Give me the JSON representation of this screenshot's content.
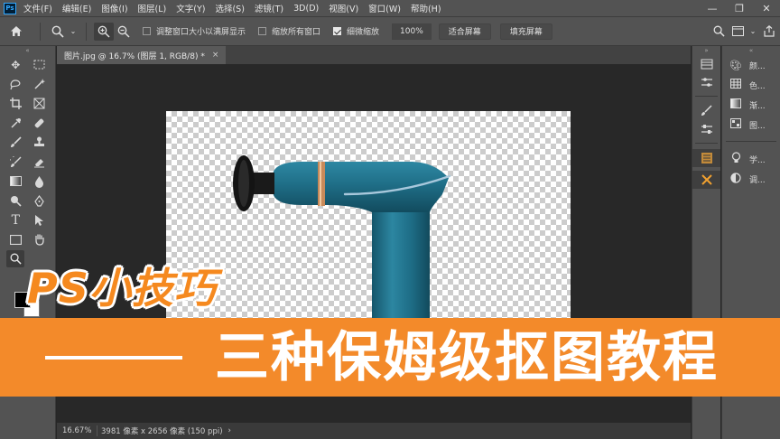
{
  "app": {
    "logo_text": "Ps"
  },
  "menu": [
    "文件(F)",
    "编辑(E)",
    "图像(I)",
    "图层(L)",
    "文字(Y)",
    "选择(S)",
    "滤镜(T)",
    "3D(D)",
    "视图(V)",
    "窗口(W)",
    "帮助(H)"
  ],
  "window_controls": {
    "minimize": "—",
    "maximize": "❐",
    "close": "✕"
  },
  "options_bar": {
    "resize_windows_label": "调整窗口大小以满屏显示",
    "resize_windows_checked": false,
    "zoom_all_label": "缩放所有窗口",
    "zoom_all_checked": false,
    "scrubby_zoom_label": "细微缩放",
    "scrubby_zoom_checked": true,
    "percent_button": "100%",
    "fit_screen_button": "适合屏幕",
    "fill_screen_button": "填充屏幕"
  },
  "document": {
    "tab_title": "图片.jpg @ 16.7% (图层 1, RGB/8) *",
    "close_glyph": "×"
  },
  "status": {
    "zoom": "16.67%",
    "doc_info": "3981 像素 x 2656 像素 (150 ppi)",
    "arrow": "›"
  },
  "panels": [
    {
      "icon": "palette-icon",
      "label": "颜..."
    },
    {
      "icon": "swatches-icon",
      "label": "色..."
    },
    {
      "icon": "gradients-icon",
      "label": "渐..."
    },
    {
      "icon": "patterns-icon",
      "label": "图..."
    },
    {
      "icon": "learn-icon",
      "label": "学..."
    },
    {
      "icon": "adjustments-icon",
      "label": "调..."
    }
  ],
  "overlay": {
    "title": "PS小技巧",
    "banner_text": "三种保姆级抠图教程"
  },
  "colors": {
    "ui_dark": "#535353",
    "canvas_bg": "#282828",
    "accent_orange": "#f38a2a",
    "product_teal": "#1e6a82"
  }
}
